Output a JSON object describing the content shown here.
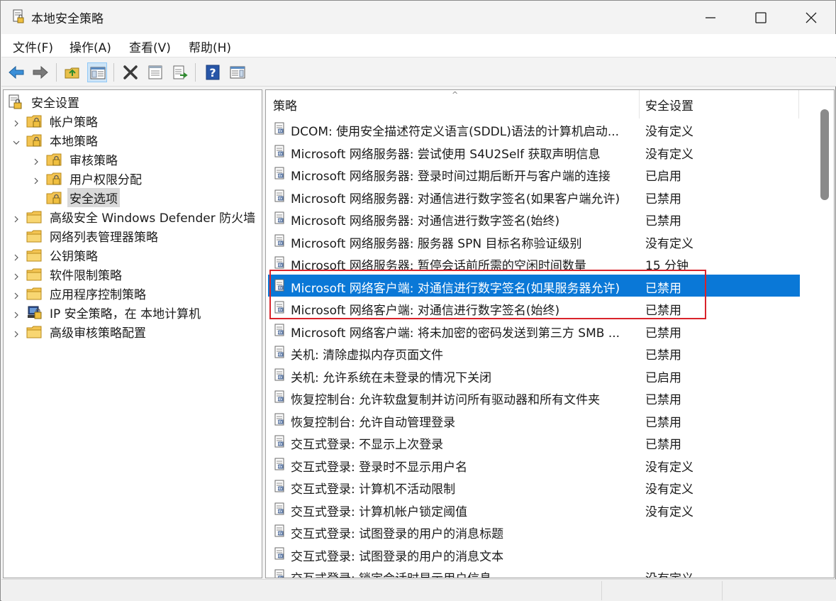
{
  "window": {
    "title": "本地安全策略"
  },
  "menu": [
    "文件(F)",
    "操作(A)",
    "查看(V)",
    "帮助(H)"
  ],
  "toolbar": {
    "buttons": [
      "back-icon",
      "forward-icon",
      "up-folder-icon",
      "show-hide-tree-icon",
      "delete-icon",
      "properties-icon",
      "export-list-icon",
      "help-icon",
      "show-action-pane-icon"
    ]
  },
  "tree": {
    "root": "安全设置",
    "items": [
      {
        "label": "帐户策略"
      },
      {
        "label": "本地策略"
      },
      {
        "label": "审核策略"
      },
      {
        "label": "用户权限分配"
      },
      {
        "label": "安全选项"
      },
      {
        "label": "高级安全 Windows Defender 防火墙"
      },
      {
        "label": "网络列表管理器策略"
      },
      {
        "label": "公钥策略"
      },
      {
        "label": "软件限制策略"
      },
      {
        "label": "应用程序控制策略"
      },
      {
        "label": "IP 安全策略，在 本地计算机"
      },
      {
        "label": "高级审核策略配置"
      }
    ]
  },
  "list": {
    "headers": {
      "policy": "策略",
      "setting": "安全设置"
    },
    "rows": [
      {
        "policy": "DCOM: 使用安全描述符定义语言(SDDL)语法的计算机启动...",
        "setting": "没有定义"
      },
      {
        "policy": "Microsoft 网络服务器: 尝试使用 S4U2Self 获取声明信息",
        "setting": "没有定义"
      },
      {
        "policy": "Microsoft 网络服务器: 登录时间过期后断开与客户端的连接",
        "setting": "已启用"
      },
      {
        "policy": "Microsoft 网络服务器: 对通信进行数字签名(如果客户端允许)",
        "setting": "已禁用"
      },
      {
        "policy": "Microsoft 网络服务器: 对通信进行数字签名(始终)",
        "setting": "已禁用"
      },
      {
        "policy": "Microsoft 网络服务器: 服务器 SPN 目标名称验证级别",
        "setting": "没有定义"
      },
      {
        "policy": "Microsoft 网络服务器: 暂停会话前所需的空闲时间数量",
        "setting": "15 分钟"
      },
      {
        "policy": "Microsoft 网络客户端: 对通信进行数字签名(如果服务器允许)",
        "setting": "已禁用"
      },
      {
        "policy": "Microsoft 网络客户端: 对通信进行数字签名(始终)",
        "setting": "已禁用"
      },
      {
        "policy": "Microsoft 网络客户端: 将未加密的密码发送到第三方 SMB ...",
        "setting": "已禁用"
      },
      {
        "policy": "关机: 清除虚拟内存页面文件",
        "setting": "已禁用"
      },
      {
        "policy": "关机: 允许系统在未登录的情况下关闭",
        "setting": "已启用"
      },
      {
        "policy": "恢复控制台: 允许软盘复制并访问所有驱动器和所有文件夹",
        "setting": "已禁用"
      },
      {
        "policy": "恢复控制台: 允许自动管理登录",
        "setting": "已禁用"
      },
      {
        "policy": "交互式登录: 不显示上次登录",
        "setting": "已禁用"
      },
      {
        "policy": "交互式登录: 登录时不显示用户名",
        "setting": "没有定义"
      },
      {
        "policy": "交互式登录: 计算机不活动限制",
        "setting": "没有定义"
      },
      {
        "policy": "交互式登录: 计算机帐户锁定阈值",
        "setting": "没有定义"
      },
      {
        "policy": "交互式登录: 试图登录的用户的消息标题",
        "setting": ""
      },
      {
        "policy": "交互式登录: 试图登录的用户的消息文本",
        "setting": ""
      },
      {
        "policy": "交互式登录: 锁定会话时显示用户信息",
        "setting": "没有定义"
      }
    ],
    "selected_index": 7
  },
  "colors": {
    "selection": "#0a78d7",
    "highlight_box": "#d9232a",
    "folder": "#f3c452"
  }
}
